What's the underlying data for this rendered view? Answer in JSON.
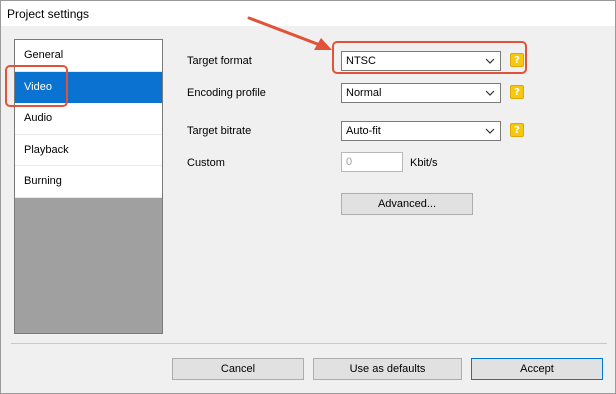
{
  "window": {
    "title": "Project settings"
  },
  "sidebar": {
    "items": [
      {
        "label": "General",
        "active": false
      },
      {
        "label": "Video",
        "active": true
      },
      {
        "label": "Audio",
        "active": false
      },
      {
        "label": "Playback",
        "active": false
      },
      {
        "label": "Burning",
        "active": false
      }
    ]
  },
  "video": {
    "target_format_label": "Target format",
    "target_format_value": "NTSC",
    "encoding_profile_label": "Encoding profile",
    "encoding_profile_value": "Normal",
    "target_bitrate_label": "Target bitrate",
    "target_bitrate_value": "Auto-fit",
    "custom_label": "Custom",
    "custom_value": "0",
    "custom_unit": "Kbit/s",
    "advanced_label": "Advanced...",
    "help_glyph": "?"
  },
  "footer": {
    "cancel_label": "Cancel",
    "defaults_label": "Use as defaults",
    "accept_label": "Accept"
  },
  "colors": {
    "annotation": "#e0533a",
    "selection": "#0a73d1",
    "help_badge": "#f6c80e"
  }
}
